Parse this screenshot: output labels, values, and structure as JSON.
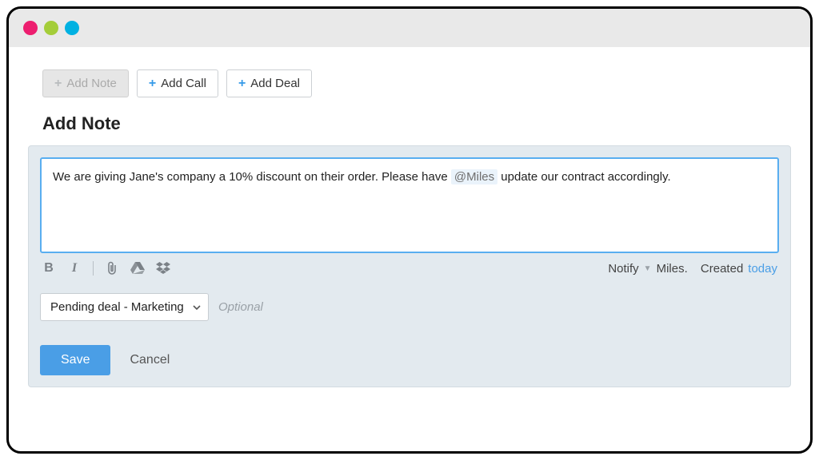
{
  "tabs": {
    "add_note": "Add Note",
    "add_call": "Add Call",
    "add_deal": "Add Deal"
  },
  "section_title": "Add Note",
  "note": {
    "text_before": "We are giving Jane's company a 10% discount on their order. Please have ",
    "mention": "@Miles",
    "text_after": " update our contract accordingly."
  },
  "toolbar": {
    "notify_label": "Notify",
    "notify_value": "Miles.",
    "created_label": "Created",
    "created_value": "today"
  },
  "deal": {
    "selected": "Pending deal - Marketing",
    "optional_label": "Optional"
  },
  "actions": {
    "save": "Save",
    "cancel": "Cancel"
  }
}
